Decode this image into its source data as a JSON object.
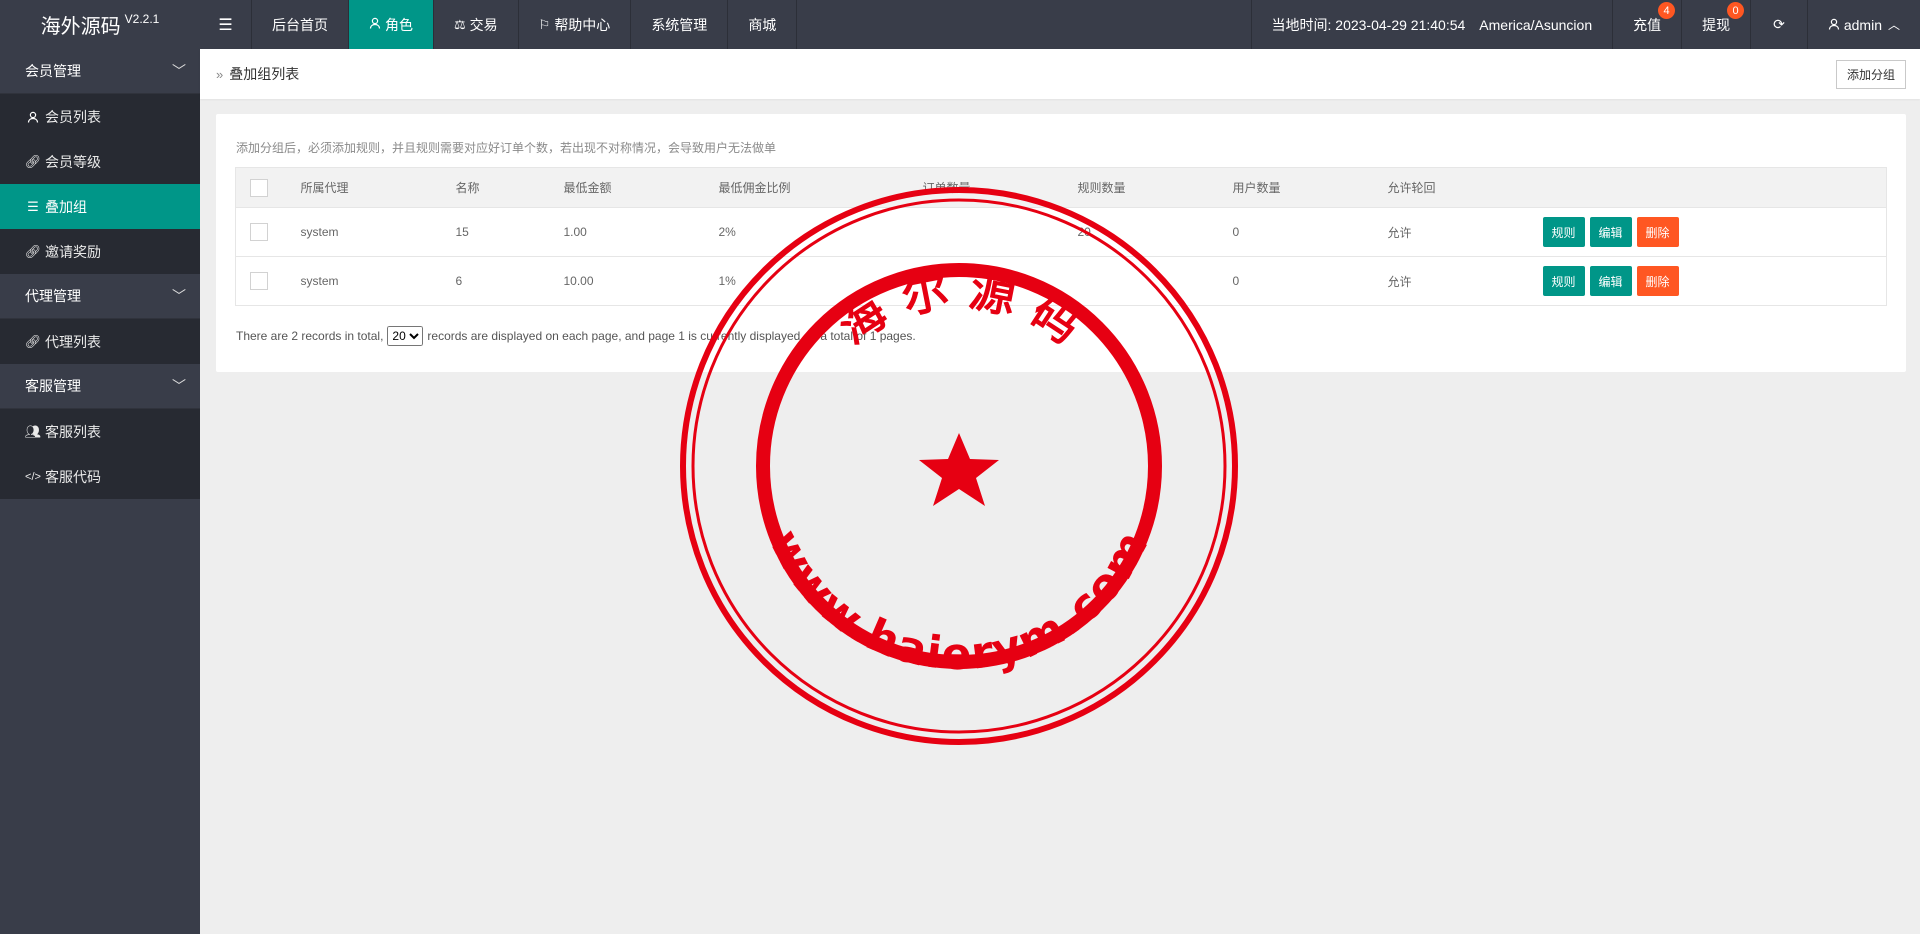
{
  "app": {
    "name": "海外源码",
    "version": "V2.2.1"
  },
  "nav": {
    "toggle_icon": "menu-fold-icon",
    "items": [
      {
        "label": "后台首页",
        "icon": "",
        "active": false
      },
      {
        "label": "角色",
        "icon": "user-icon",
        "active": true
      },
      {
        "label": "交易",
        "icon": "scale-icon",
        "active": false
      },
      {
        "label": "帮助中心",
        "icon": "flag-icon",
        "active": false
      },
      {
        "label": "系统管理",
        "icon": "",
        "active": false
      },
      {
        "label": "商城",
        "icon": "",
        "active": false
      }
    ]
  },
  "topright": {
    "time_label": "当地时间: 2023-04-29 21:40:54",
    "timezone": "America/Asuncion",
    "recharge": {
      "label": "充值",
      "badge": "4"
    },
    "withdraw": {
      "label": "提现",
      "badge": "0"
    },
    "refresh_icon": "refresh-icon",
    "user": "admin"
  },
  "sidebar": {
    "groups": [
      {
        "label": "会员管理",
        "items": [
          {
            "label": "会员列表",
            "icon": "user-icon",
            "active": false
          },
          {
            "label": "会员等级",
            "icon": "link-icon",
            "active": false
          },
          {
            "label": "叠加组",
            "icon": "list-icon",
            "active": true
          },
          {
            "label": "邀请奖励",
            "icon": "link-icon",
            "active": false
          }
        ]
      },
      {
        "label": "代理管理",
        "items": [
          {
            "label": "代理列表",
            "icon": "link-icon",
            "active": false
          }
        ]
      },
      {
        "label": "客服管理",
        "items": [
          {
            "label": "客服列表",
            "icon": "users-icon",
            "active": false
          },
          {
            "label": "客服代码",
            "icon": "code-icon",
            "active": false
          }
        ]
      }
    ]
  },
  "breadcrumb": {
    "title": "叠加组列表",
    "add_button": "添加分组"
  },
  "tip": "添加分组后，必须添加规则，并且规则需要对应好订单个数，若出现不对称情况，会导致用户无法做单",
  "table": {
    "columns": [
      "所属代理",
      "名称",
      "最低金额",
      "最低佣金比例",
      "订单数量",
      "规则数量",
      "用户数量",
      "允许轮回"
    ],
    "rows": [
      {
        "agent": "system",
        "name": "15",
        "min_amount": "1.00",
        "min_rate": "2%",
        "orders": "",
        "rules": "20",
        "users": "0",
        "allow": "允许"
      },
      {
        "agent": "system",
        "name": "6",
        "min_amount": "10.00",
        "min_rate": "1%",
        "orders": "",
        "rules": "",
        "users": "0",
        "allow": "允许"
      }
    ],
    "actions": {
      "rule": "规则",
      "edit": "编辑",
      "delete": "删除"
    }
  },
  "pager": {
    "prefix": "There are 2 records in total,",
    "per_page": "20",
    "suffix": "records are displayed on each page, and page 1 is currently displayed on a total of 1 pages."
  },
  "stamp": {
    "top_text": "海 尔 源 码",
    "bottom_text": "www.haierym.com",
    "color": "#e60012"
  }
}
